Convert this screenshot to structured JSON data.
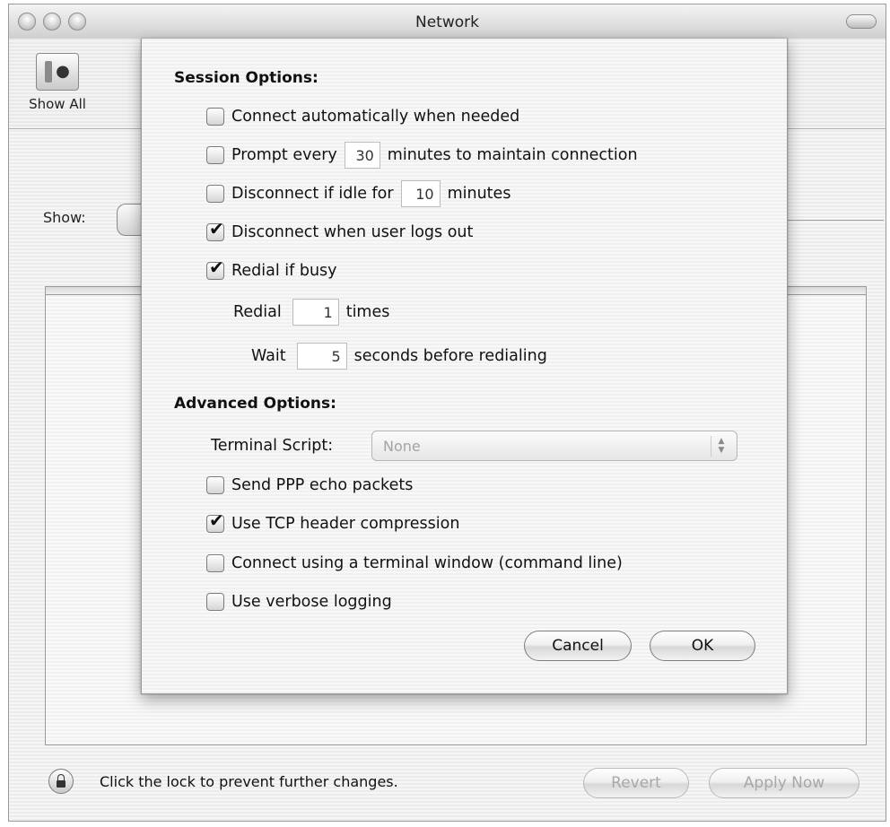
{
  "window": {
    "title": "Network"
  },
  "toolbar": {
    "show_all_label": "Show All"
  },
  "background": {
    "show_label": "Show:",
    "lock_text": "Click the lock to prevent further changes.",
    "revert_label": "Revert",
    "apply_label": "Apply Now"
  },
  "sheet": {
    "session_title": "Session Options:",
    "options": [
      {
        "label": "Connect automatically when needed",
        "checked": false
      },
      {
        "label_before": "Prompt every",
        "value": "30",
        "label_after": "minutes to maintain connection",
        "checked": false
      },
      {
        "label_before": "Disconnect if idle for",
        "value": "10",
        "label_after": "minutes",
        "checked": false
      },
      {
        "label": "Disconnect when user logs out",
        "checked": true
      },
      {
        "label": "Redial if busy",
        "checked": true
      }
    ],
    "redial": {
      "label_before": "Redial",
      "value": "1",
      "label_after": "times"
    },
    "wait": {
      "label_before": "Wait",
      "value": "5",
      "label_after": "seconds before redialing"
    },
    "advanced_title": "Advanced Options:",
    "terminal_script_label": "Terminal Script:",
    "terminal_script_value": "None",
    "advanced": [
      {
        "label": "Send PPP echo packets",
        "checked": false
      },
      {
        "label": "Use TCP header compression",
        "checked": true
      },
      {
        "label": "Connect using a terminal window (command line)",
        "checked": false
      },
      {
        "label": "Use verbose logging",
        "checked": false
      }
    ],
    "cancel_label": "Cancel",
    "ok_label": "OK"
  },
  "colors": {
    "window_stripe": "#ececec",
    "button_border": "#7e7e7e",
    "disabled_text": "#a8a8a8"
  },
  "icons": {
    "checkbox_mark": "✔",
    "show_all": "apple-icon",
    "lock": "lock-icon"
  }
}
